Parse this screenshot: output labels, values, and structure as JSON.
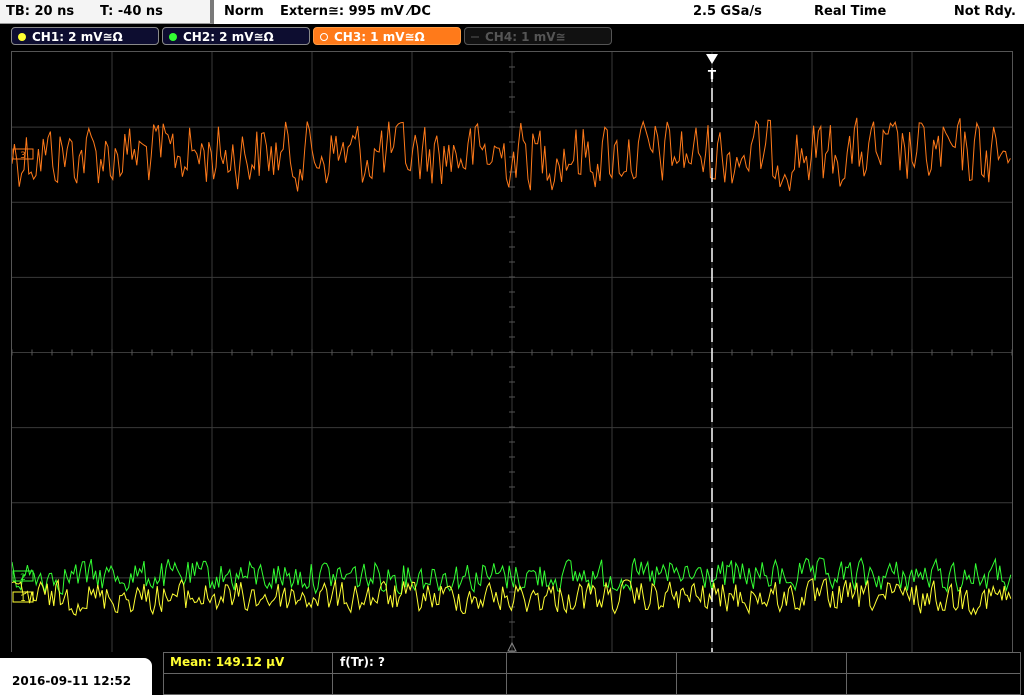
{
  "topbar": {
    "timebase": "TB: 20 ns",
    "trigger_offset": "T: -40 ns",
    "mode": "Norm",
    "trigger_source": "Extern≅: 995 mV ⁄DC",
    "sample_rate": "2.5 GSa/s",
    "acq_mode": "Real Time",
    "status": "Not Rdy."
  },
  "channels": [
    {
      "label": "CH1: 2 mV≅Ω",
      "color": "#ffff33",
      "state": "on"
    },
    {
      "label": "CH2: 2 mV≅Ω",
      "color": "#33ff33",
      "state": "on"
    },
    {
      "label": "CH3: 1 mV≅Ω",
      "color": "#ff7a1a",
      "state": "active"
    },
    {
      "label": "CH4: 1 mV≅",
      "color": "#555555",
      "state": "off"
    }
  ],
  "screen": {
    "trigger_marker": "T",
    "trigger_fraction": 0.7,
    "ch_markers": [
      "3",
      "2",
      "1"
    ]
  },
  "bottom": {
    "datetime": "2016-09-11 12:52",
    "mean": "Mean: 149.12 µV",
    "freq": "f(Tr): ?"
  }
}
